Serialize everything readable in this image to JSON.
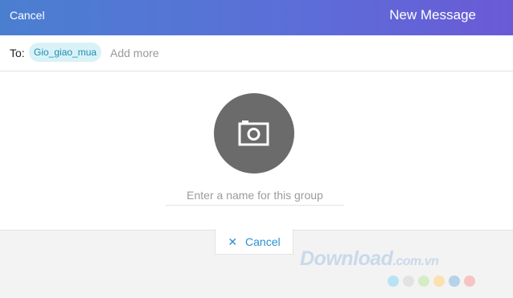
{
  "header": {
    "cancel_label": "Cancel",
    "title": "New Message"
  },
  "to_row": {
    "label": "To:",
    "recipients": [
      {
        "name": "Gio_giao_mua"
      }
    ],
    "add_more_label": "Add more"
  },
  "group": {
    "avatar_icon": "camera-icon",
    "name_placeholder": "Enter a name for this group",
    "name_value": ""
  },
  "footer": {
    "cancel_icon": "✕",
    "cancel_label": "Cancel"
  },
  "watermark": {
    "brand": "Download",
    "domain": ".com.vn",
    "dot_colors": [
      "#b7e3f3",
      "#e2e2e2",
      "#d6ecc6",
      "#fbe0b0",
      "#b6d2ea",
      "#f6c4c4"
    ]
  },
  "colors": {
    "accent_start": "#4a7fd0",
    "accent_end": "#6a5ad6",
    "chip_bg": "#d9f2f8",
    "chip_text": "#1e8fb0",
    "link": "#2a8fd4"
  }
}
